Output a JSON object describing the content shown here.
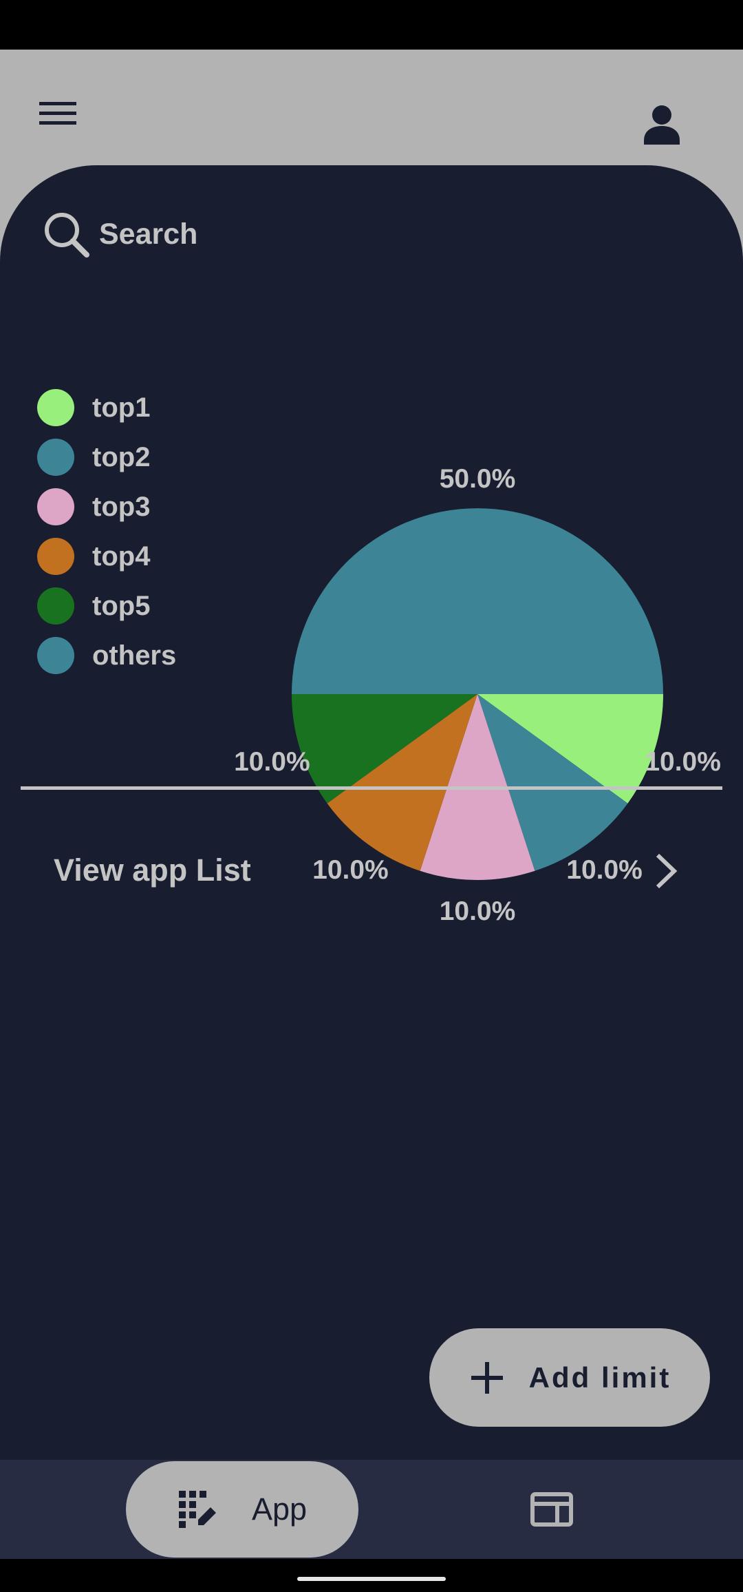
{
  "theme": {
    "background": "#b3b3b3",
    "card": "#181d30",
    "text": "#c4c4c4",
    "nav_bar": "#272c42"
  },
  "header": {
    "menu_icon": "hamburger-menu-icon",
    "profile_icon": "person-icon"
  },
  "search": {
    "icon": "search-icon",
    "label": "Search"
  },
  "chart_data": {
    "type": "pie",
    "title": "",
    "legend_position": "left",
    "legend": [
      {
        "name": "top1",
        "color": "#98ef7c"
      },
      {
        "name": "top2",
        "color": "#3d8596"
      },
      {
        "name": "top3",
        "color": "#dda6c7"
      },
      {
        "name": "top4",
        "color": "#c1711f"
      },
      {
        "name": "top5",
        "color": "#187220"
      },
      {
        "name": "others",
        "color": "#3d8596"
      }
    ],
    "slices": [
      {
        "name": "top1",
        "value": 10.0,
        "label": "10.0%",
        "color": "#98ef7c"
      },
      {
        "name": "top2",
        "value": 10.0,
        "label": "10.0%",
        "color": "#3d8596"
      },
      {
        "name": "top3",
        "value": 10.0,
        "label": "10.0%",
        "color": "#dda6c7"
      },
      {
        "name": "top4",
        "value": 10.0,
        "label": "10.0%",
        "color": "#c1711f"
      },
      {
        "name": "top5",
        "value": 10.0,
        "label": "10.0%",
        "color": "#187220"
      },
      {
        "name": "others",
        "value": 50.0,
        "label": "50.0%",
        "color": "#3d8596"
      }
    ]
  },
  "view_list": {
    "label": "View app List",
    "icon": "chevron-right-icon"
  },
  "fab": {
    "icon": "plus-icon",
    "label": "Add limit"
  },
  "bottom_nav": {
    "items": [
      {
        "label": "App",
        "icon": "apps-edit-icon",
        "selected": true
      },
      {
        "label": "",
        "icon": "web-layout-icon",
        "selected": false
      }
    ]
  }
}
